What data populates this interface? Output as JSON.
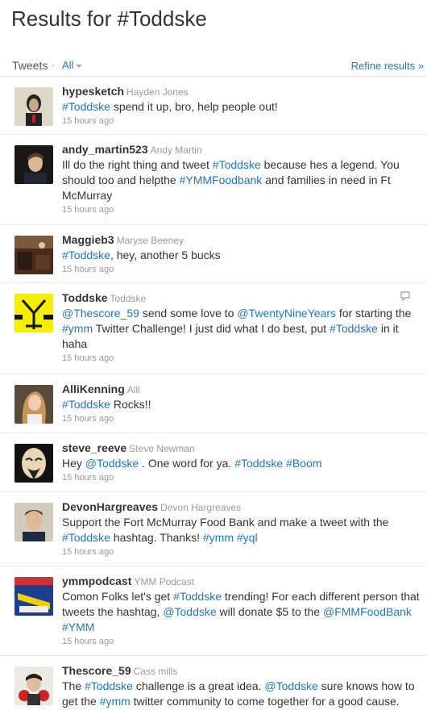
{
  "header": {
    "title": "Results for #Toddske"
  },
  "tabs": {
    "tweets_label": "Tweets",
    "separator": "·",
    "all_label": "All",
    "refine_label": "Refine results »"
  },
  "tweets": [
    {
      "username": "hypesketch",
      "fullname": "Hayden Jones",
      "time": "15 hours ago",
      "parts": [
        {
          "t": "#Toddske",
          "l": true
        },
        {
          "t": " spend it up, bro, help people out!"
        }
      ]
    },
    {
      "username": "andy_martin523",
      "fullname": "Andy Martin",
      "time": "15 hours ago",
      "parts": [
        {
          "t": "Ill do the right thing and tweet "
        },
        {
          "t": "#Toddske",
          "l": true
        },
        {
          "t": " because hes a legend. You should too and helpthe "
        },
        {
          "t": "#YMMFoodbank",
          "l": true
        },
        {
          "t": " and families in need in Ft McMurray"
        }
      ]
    },
    {
      "username": "Maggieb3",
      "fullname": "Maryse Beeney",
      "time": "15 hours ago",
      "parts": [
        {
          "t": "#Toddske",
          "l": true
        },
        {
          "t": ", hey, another 5 bucks"
        }
      ]
    },
    {
      "username": "Toddske",
      "fullname": "Toddske",
      "time": "15 hours ago",
      "parts": [
        {
          "t": "@Thescore_59",
          "l": true
        },
        {
          "t": " send some love to "
        },
        {
          "t": "@TwentyNineYears",
          "l": true
        },
        {
          "t": " for starting the "
        },
        {
          "t": "#ymm",
          "l": true
        },
        {
          "t": " Twitter Challenge! I just did what I do best, put "
        },
        {
          "t": "#Toddske",
          "l": true
        },
        {
          "t": " in it haha"
        }
      ]
    },
    {
      "username": "AlliKenning",
      "fullname": "Alli",
      "time": "15 hours ago",
      "parts": [
        {
          "t": "#Toddske",
          "l": true
        },
        {
          "t": " Rocks!!"
        }
      ]
    },
    {
      "username": "steve_reeve",
      "fullname": "Steve Newman",
      "time": "15 hours ago",
      "parts": [
        {
          "t": "Hey "
        },
        {
          "t": "@Toddske",
          "l": true
        },
        {
          "t": " . One word for ya. "
        },
        {
          "t": "#Toddske",
          "l": true
        },
        {
          "t": " "
        },
        {
          "t": "#Boom",
          "l": true
        }
      ]
    },
    {
      "username": "DevonHargreaves",
      "fullname": "Devon Hargreaves",
      "time": "15 hours ago",
      "parts": [
        {
          "t": "Support the Fort McMurray Food Bank and make a tweet with the "
        },
        {
          "t": "#Toddske",
          "l": true
        },
        {
          "t": " hashtag. Thanks! "
        },
        {
          "t": "#ymm",
          "l": true
        },
        {
          "t": " "
        },
        {
          "t": "#yql",
          "l": true
        }
      ]
    },
    {
      "username": "ymmpodcast",
      "fullname": "YMM Podcast",
      "time": "15 hours ago",
      "parts": [
        {
          "t": "Comon Folks let's get "
        },
        {
          "t": "#Toddske",
          "l": true
        },
        {
          "t": " trending! For each different person that tweets the hashtag, "
        },
        {
          "t": "@Toddske",
          "l": true
        },
        {
          "t": " will donate $5 to the "
        },
        {
          "t": "@FMMFoodBank",
          "l": true
        },
        {
          "t": " "
        },
        {
          "t": "#YMM",
          "l": true
        }
      ]
    },
    {
      "username": "Thescore_59",
      "fullname": "Cass mills",
      "time": "",
      "parts": [
        {
          "t": "The "
        },
        {
          "t": "#Toddske",
          "l": true
        },
        {
          "t": " challenge is a great idea. "
        },
        {
          "t": "@Toddske",
          "l": true
        },
        {
          "t": " sure knows how to get the "
        },
        {
          "t": "#ymm",
          "l": true
        },
        {
          "t": " twitter community to come together for a good cause."
        }
      ]
    }
  ]
}
